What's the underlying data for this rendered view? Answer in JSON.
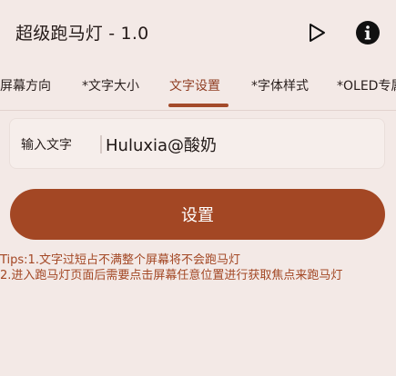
{
  "app": {
    "title": "超级跑马灯 - 1.0"
  },
  "icons": {
    "play": "play-icon",
    "info": "info-icon"
  },
  "tabs": [
    {
      "label": "屏幕方向",
      "active": false
    },
    {
      "label": "*文字大小",
      "active": false
    },
    {
      "label": "文字设置",
      "active": true
    },
    {
      "label": "*字体样式",
      "active": false
    },
    {
      "label": "*OLED专属",
      "active": false
    }
  ],
  "form": {
    "label": "输入文字",
    "value": "Huluxia@酸奶",
    "button_label": "设置"
  },
  "tips": [
    "Tips:1.文字过短占不满整个屏幕将不会跑马灯",
    "2.进入跑马灯页面后需要点击屏幕任意位置进行获取焦点来跑马灯"
  ],
  "colors": {
    "accent": "#a34724",
    "background": "#f3e9e6"
  }
}
